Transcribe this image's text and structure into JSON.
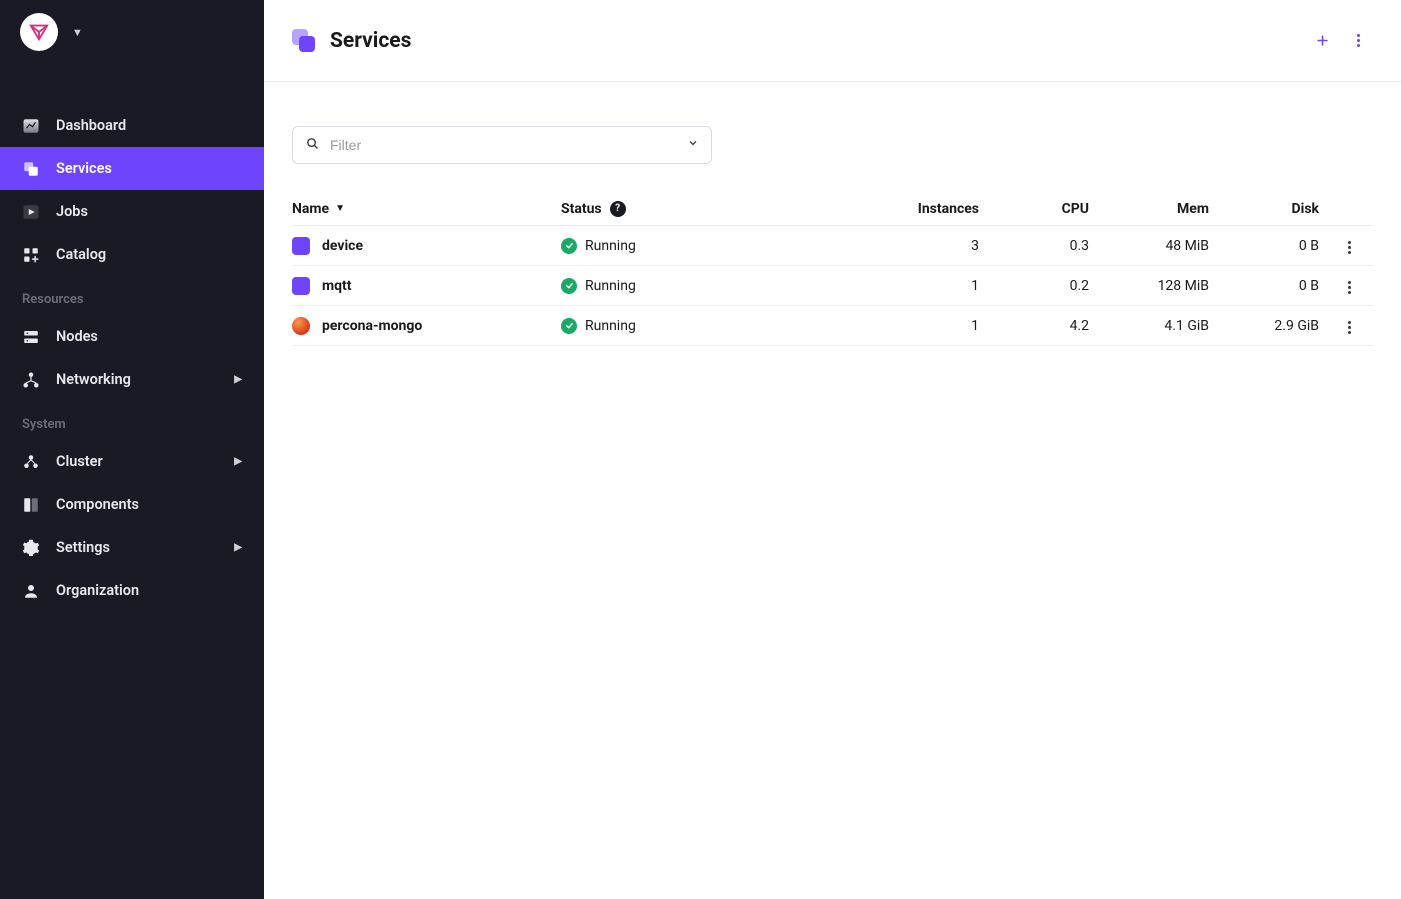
{
  "sidebar": {
    "top_items": [
      {
        "label": "Dashboard",
        "icon": "gauge-icon"
      },
      {
        "label": "Services",
        "icon": "services-icon",
        "active": true
      },
      {
        "label": "Jobs",
        "icon": "play-icon"
      },
      {
        "label": "Catalog",
        "icon": "grid-add-icon"
      }
    ],
    "sections": [
      {
        "label": "Resources",
        "items": [
          {
            "label": "Nodes",
            "icon": "servers-icon"
          },
          {
            "label": "Networking",
            "icon": "network-icon",
            "expandable": true
          }
        ]
      },
      {
        "label": "System",
        "items": [
          {
            "label": "Cluster",
            "icon": "cluster-icon",
            "expandable": true
          },
          {
            "label": "Components",
            "icon": "components-icon"
          },
          {
            "label": "Settings",
            "icon": "gear-icon",
            "expandable": true
          },
          {
            "label": "Organization",
            "icon": "person-icon"
          }
        ]
      }
    ]
  },
  "header": {
    "title": "Services"
  },
  "filter": {
    "placeholder": "Filter"
  },
  "table": {
    "columns": {
      "name": "Name",
      "status": "Status",
      "instances": "Instances",
      "cpu": "CPU",
      "mem": "Mem",
      "disk": "Disk"
    },
    "help_glyph": "?",
    "rows": [
      {
        "name": "device",
        "icon_variant": "purple",
        "status": "Running",
        "instances": "3",
        "cpu": "0.3",
        "mem": "48 MiB",
        "disk": "0 B"
      },
      {
        "name": "mqtt",
        "icon_variant": "purple",
        "status": "Running",
        "instances": "1",
        "cpu": "0.2",
        "mem": "128 MiB",
        "disk": "0 B"
      },
      {
        "name": "percona-mongo",
        "icon_variant": "red",
        "status": "Running",
        "instances": "1",
        "cpu": "4.2",
        "mem": "4.1 GiB",
        "disk": "2.9 GiB"
      }
    ]
  },
  "colors": {
    "accent": "#6e44ff",
    "sidebar_bg": "#1a1a24",
    "status_running": "#1aaa66"
  }
}
